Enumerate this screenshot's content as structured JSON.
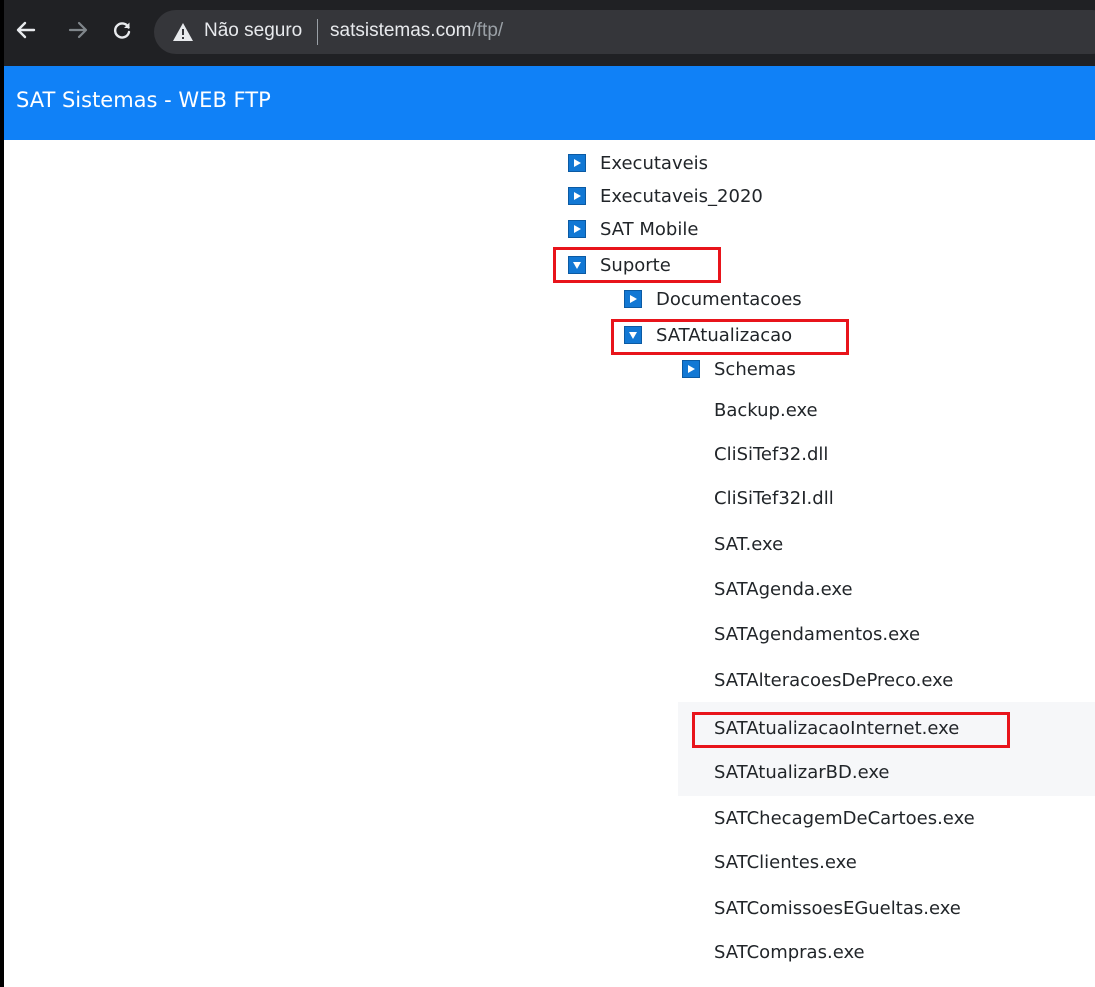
{
  "browser": {
    "insecure_label": "Não seguro",
    "url_host": "satsistemas.com",
    "url_path": "/ftp/"
  },
  "app": {
    "title": "SAT Sistemas - WEB FTP"
  },
  "tree": {
    "folders": [
      {
        "label": "Executaveis",
        "expanded": false
      },
      {
        "label": "Executaveis_2020",
        "expanded": false
      },
      {
        "label": "SAT Mobile",
        "expanded": false
      },
      {
        "label": "Suporte",
        "expanded": true
      },
      {
        "label": "Documentacoes",
        "expanded": false
      },
      {
        "label": "SATAtualizacao",
        "expanded": true
      },
      {
        "label": "Schemas",
        "expanded": false
      }
    ],
    "files": [
      "Backup.exe",
      "CliSiTef32.dll",
      "CliSiTef32I.dll",
      "SAT.exe",
      "SATAgenda.exe",
      "SATAgendamentos.exe",
      "SATAlteracoesDePreco.exe",
      "SATAtualizacaoInternet.exe",
      "SATAtualizarBD.exe",
      "SATChecagemDeCartoes.exe",
      "SATClientes.exe",
      "SATComissoesEGueltas.exe",
      "SATCompras.exe"
    ]
  },
  "colors": {
    "header_blue": "#1081f7",
    "toggle_blue": "#1278d4",
    "highlight_red": "#e8141b",
    "chrome_dark": "#202124"
  }
}
